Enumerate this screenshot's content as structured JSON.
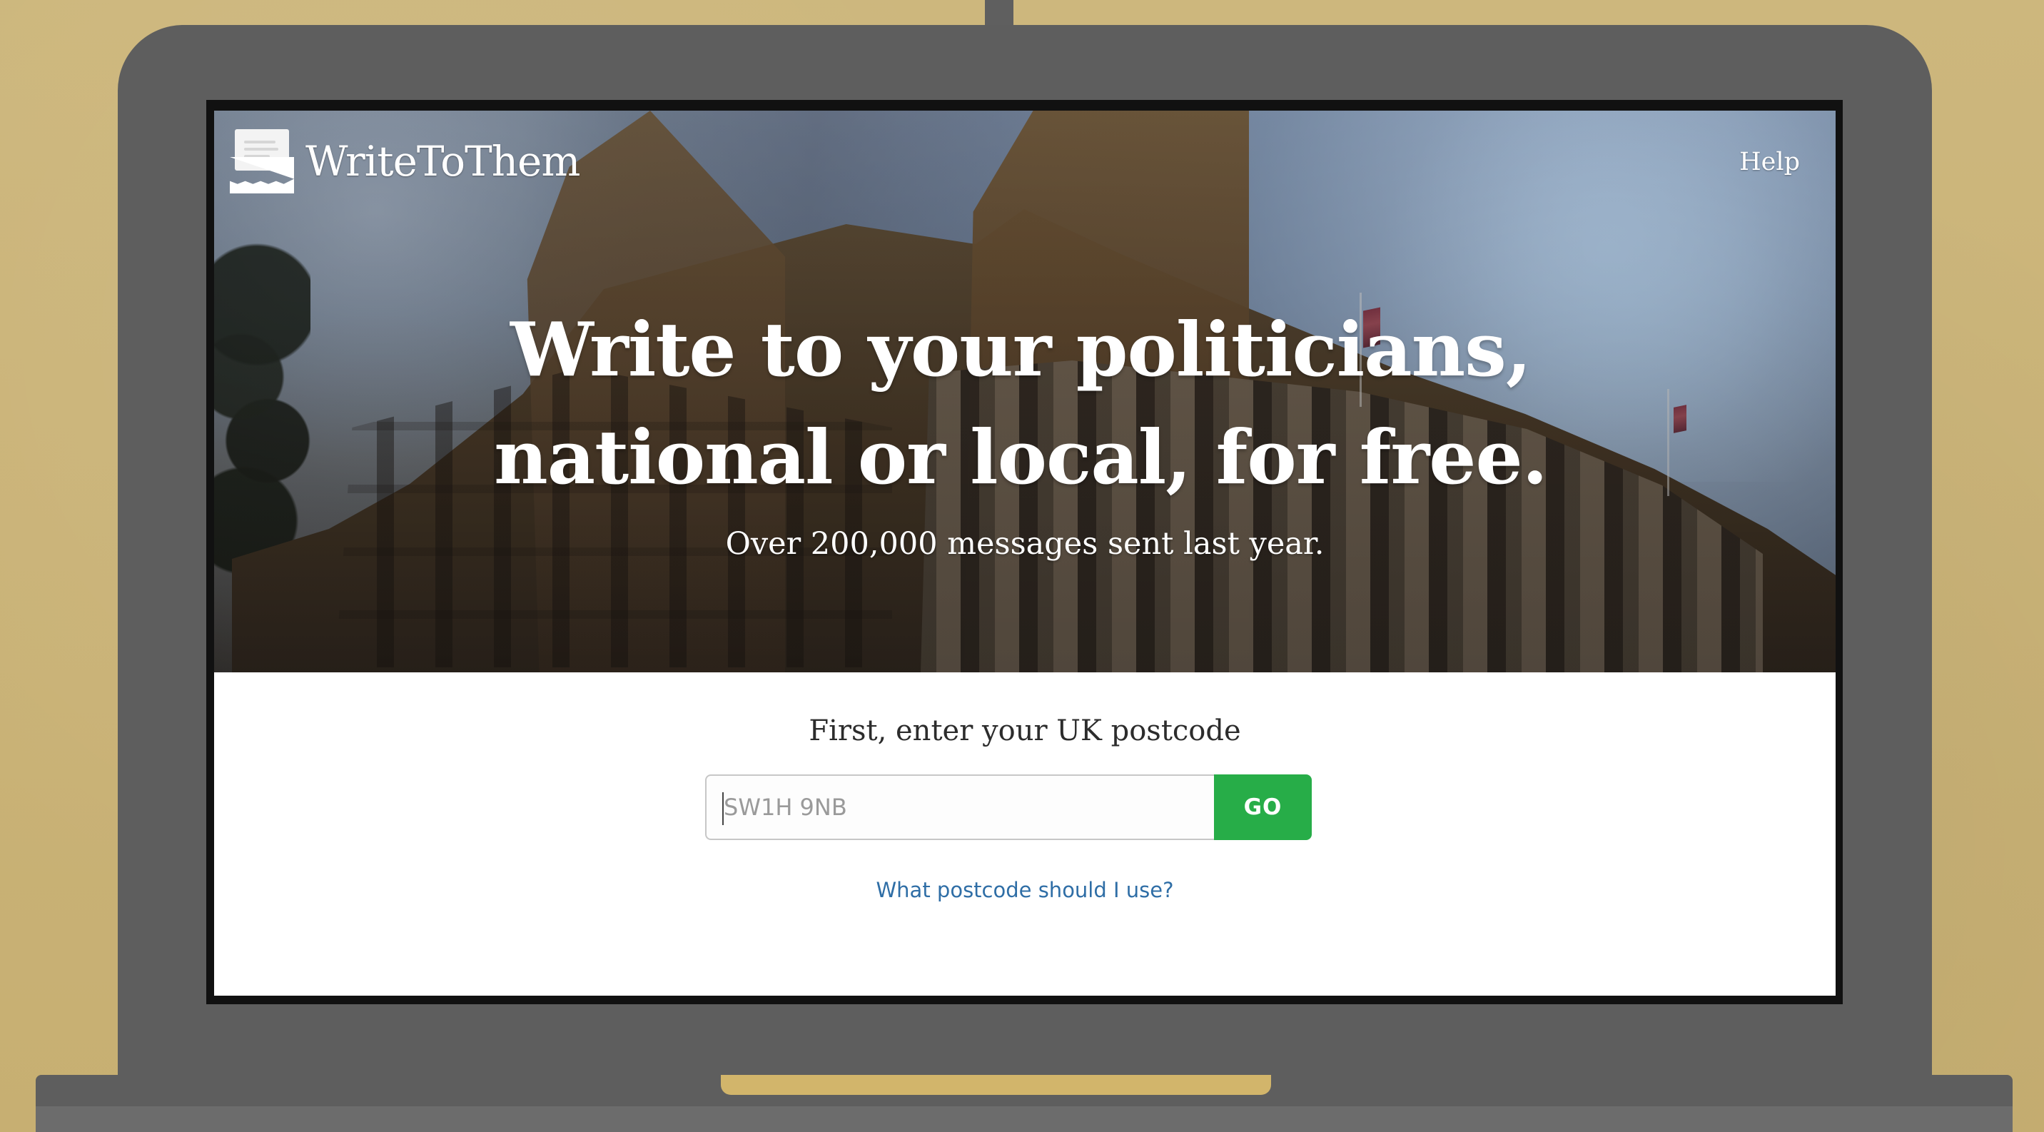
{
  "header": {
    "brand_name": "WriteToThem",
    "help_label": "Help"
  },
  "hero": {
    "title": "Write to your politicians, national or local, for free.",
    "subtitle": "Over 200,000 messages sent last year."
  },
  "postcode_form": {
    "label": "First, enter your UK postcode",
    "placeholder": "SW1H 9NB",
    "go_label": "GO",
    "help_link": "What postcode should I use?"
  },
  "icons": {
    "brand_logo": "envelope-logo-icon"
  },
  "colors": {
    "background": "#c9b277",
    "laptop": "#5e5e5e",
    "button": "#27ad48",
    "link": "#2f6ea6"
  }
}
